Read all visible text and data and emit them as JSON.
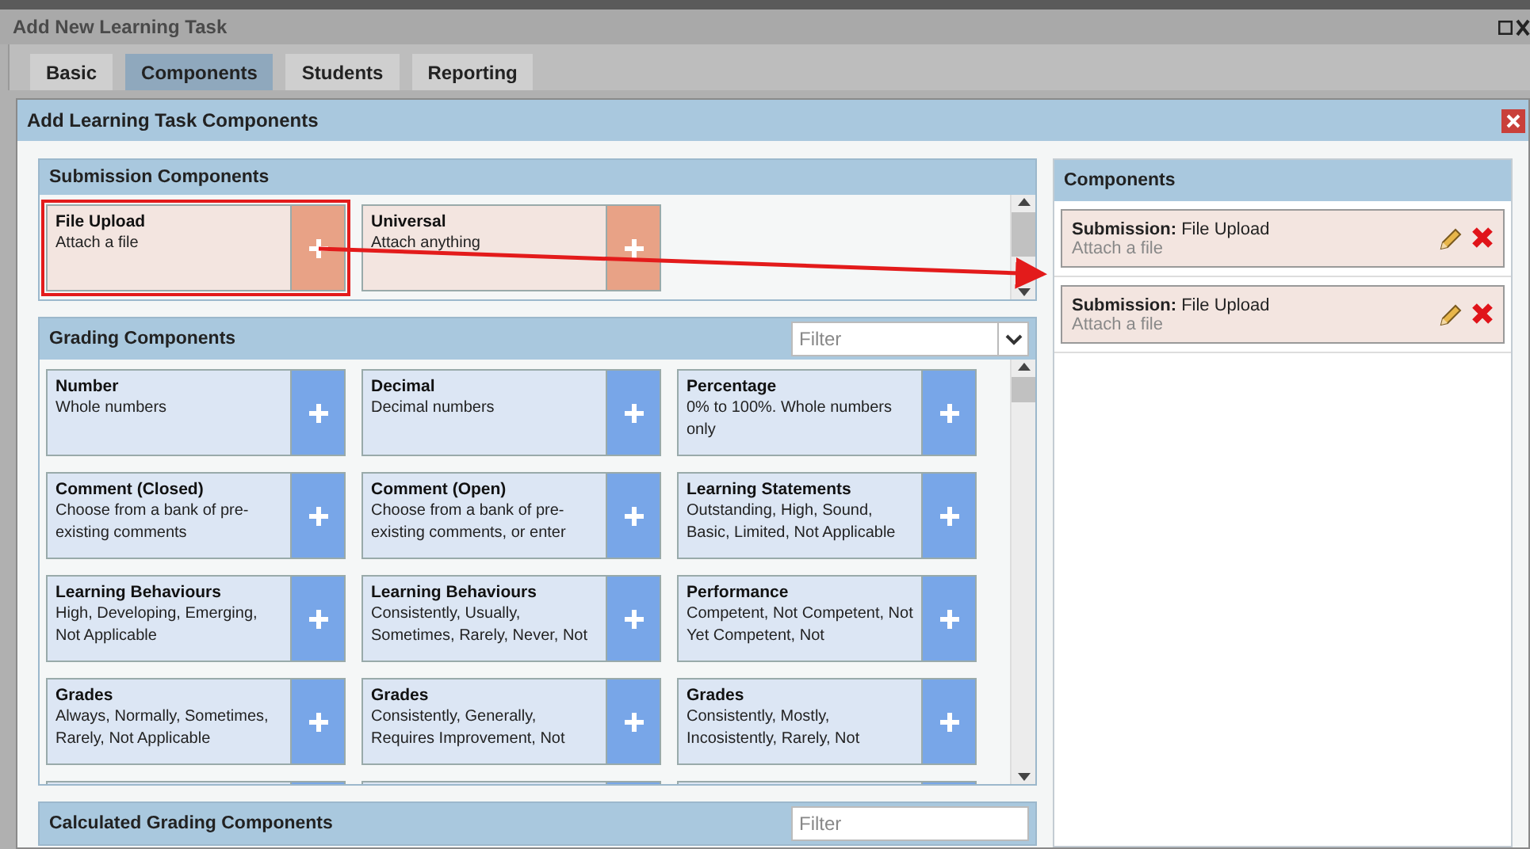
{
  "window": {
    "title": "Add New Learning Task"
  },
  "tabs": [
    {
      "label": "Basic",
      "selected": false
    },
    {
      "label": "Components",
      "selected": true
    },
    {
      "label": "Students",
      "selected": false
    },
    {
      "label": "Reporting",
      "selected": false
    }
  ],
  "dialog": {
    "title": "Add Learning Task Components",
    "sections": [
      {
        "title": "Submission Components",
        "kind": "submission",
        "items": [
          {
            "name": "File Upload",
            "description": "Attach a file",
            "highlighted": true
          },
          {
            "name": "Universal",
            "description": "Attach anything",
            "highlighted": false
          }
        ]
      },
      {
        "title": "Grading Components",
        "kind": "grading",
        "filter": {
          "placeholder": "Filter",
          "dropdown": true
        },
        "items": [
          {
            "name": "Number",
            "description": "Whole numbers",
            "highlighted": false
          },
          {
            "name": "Decimal",
            "description": "Decimal numbers",
            "highlighted": false
          },
          {
            "name": "Percentage",
            "description": "0% to 100%. Whole numbers only",
            "highlighted": false
          },
          {
            "name": "Comment (Closed)",
            "description": "Choose from a bank of pre-existing comments",
            "highlighted": false
          },
          {
            "name": "Comment (Open)",
            "description": "Choose from a bank of pre-existing comments, or enter",
            "highlighted": false
          },
          {
            "name": "Learning Statements",
            "description": "Outstanding, High, Sound, Basic, Limited, Not Applicable",
            "highlighted": false
          },
          {
            "name": "Learning Behaviours",
            "description": "High, Developing, Emerging, Not Applicable",
            "highlighted": false
          },
          {
            "name": "Learning Behaviours",
            "description": "Consistently, Usually, Sometimes, Rarely, Never, Not",
            "highlighted": false
          },
          {
            "name": "Performance",
            "description": "Competent, Not Competent, Not Yet Competent, Not",
            "highlighted": false
          },
          {
            "name": "Grades",
            "description": "Always, Normally, Sometimes, Rarely, Not Applicable",
            "highlighted": false
          },
          {
            "name": "Grades",
            "description": "Consistently, Generally, Requires Improvement, Not",
            "highlighted": false
          },
          {
            "name": "Grades",
            "description": "Consistently, Mostly, Incosistently, Rarely, Not",
            "highlighted": false
          }
        ]
      },
      {
        "title": "Calculated Grading Components",
        "kind": "calculated",
        "filter": {
          "placeholder": "Filter",
          "dropdown": false
        }
      }
    ],
    "components": {
      "title": "Components",
      "items": [
        {
          "label": "**Submission:** File Upload",
          "description": "Attach a file"
        },
        {
          "label": "**Submission:** File Upload",
          "description": "Attach a file"
        }
      ]
    }
  }
}
